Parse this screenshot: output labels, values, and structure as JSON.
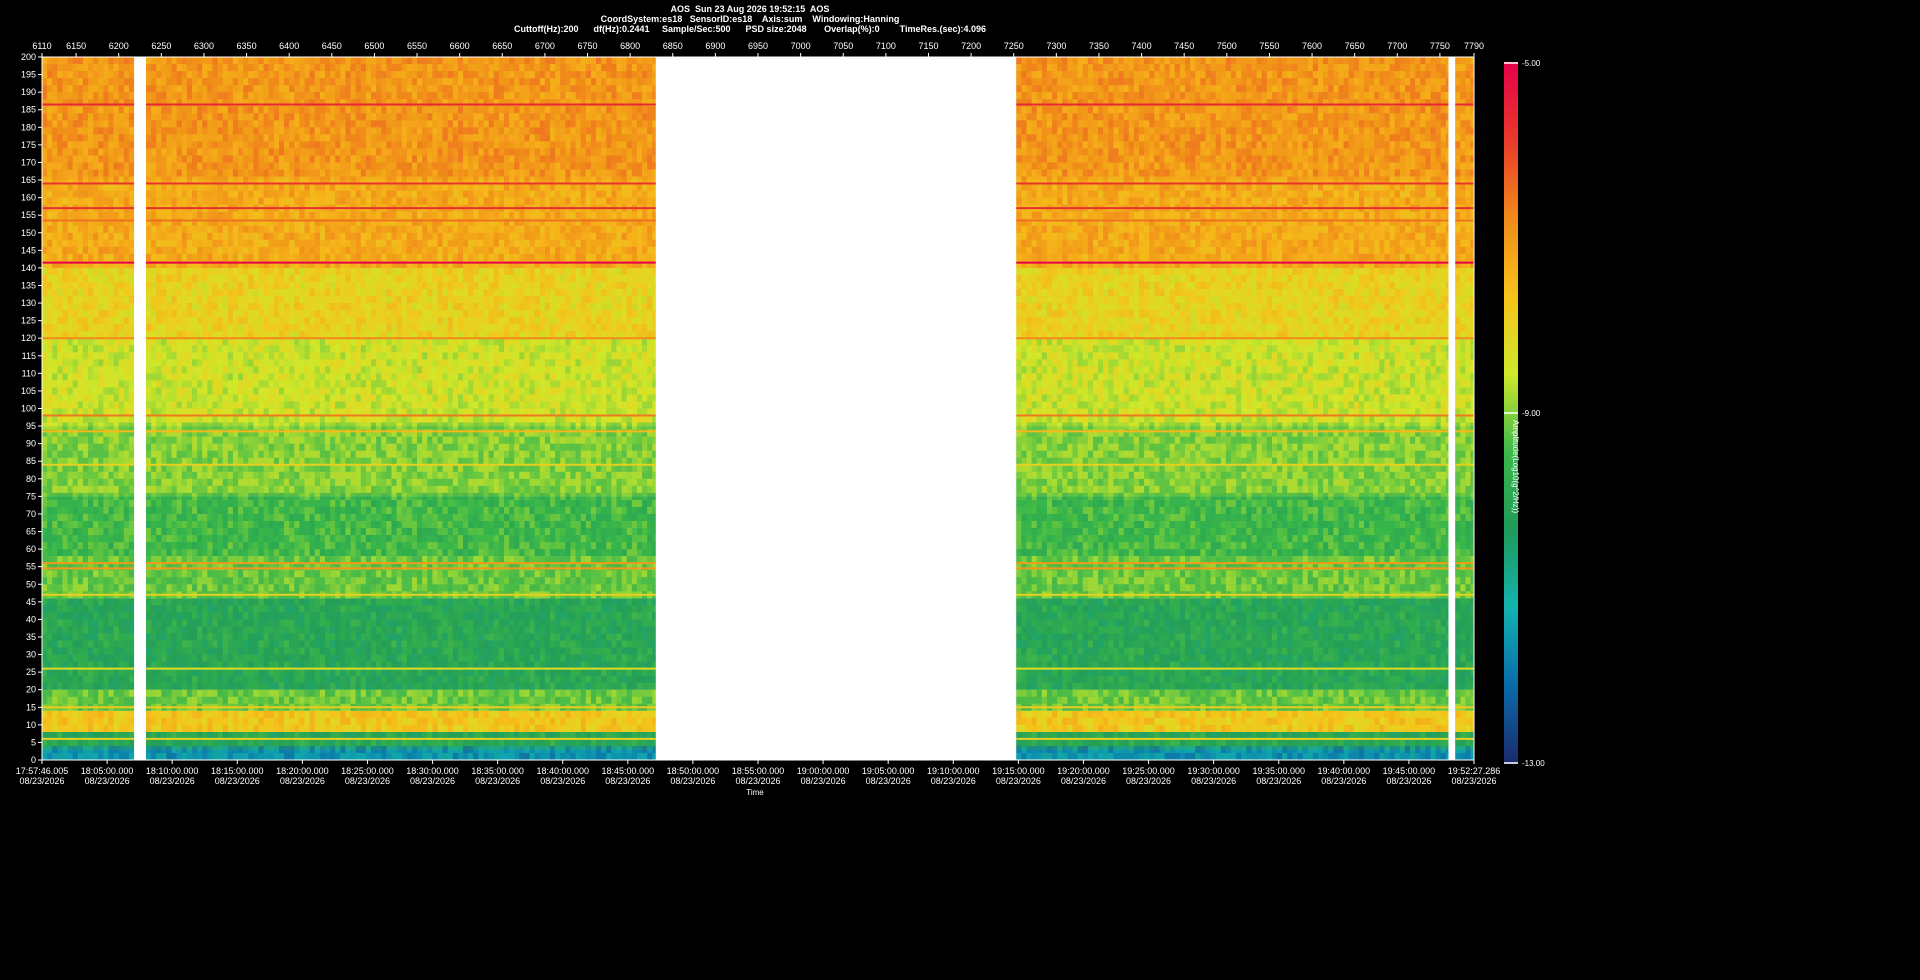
{
  "header": {
    "line1": "AOS  Sun 23 Aug 2026 19:52:15  AOS",
    "line2": "CoordSystem:es18   SensorID:es18    Axis:sum    Windowing:Hanning",
    "line3": "Cuttoff(Hz):200      df(Hz):0.2441     Sample/Sec:500      PSD size:2048       Overlap(%):0        TimeRes.(sec):4.096"
  },
  "chart_data": {
    "type": "heatmap",
    "title": "AOS  Sun 23 Aug 2026 19:52:15  AOS",
    "xlabel": "Time",
    "ylabel": "",
    "ylim": [
      0,
      200
    ],
    "top_axis": {
      "range": [
        6110,
        7790
      ],
      "ticks": [
        "6110",
        "6150",
        "6200",
        "6250",
        "6300",
        "6350",
        "6400",
        "6450",
        "6500",
        "6550",
        "6600",
        "6650",
        "6700",
        "6750",
        "6800",
        "6850",
        "6900",
        "6950",
        "7000",
        "7050",
        "7100",
        "7150",
        "7200",
        "7250",
        "7300",
        "7350",
        "7400",
        "7450",
        "7500",
        "7550",
        "7600",
        "7650",
        "7700",
        "7750",
        "7790"
      ]
    },
    "y_ticks": [
      0,
      5,
      10,
      15,
      20,
      25,
      30,
      35,
      40,
      45,
      50,
      55,
      60,
      65,
      70,
      75,
      80,
      85,
      90,
      95,
      100,
      105,
      110,
      115,
      120,
      125,
      130,
      135,
      140,
      145,
      150,
      155,
      160,
      165,
      170,
      175,
      180,
      185,
      190,
      195,
      200
    ],
    "time_ticks": [
      {
        "t": "17:57:46.005",
        "d": "08/23/2026"
      },
      {
        "t": "18:05:00.000",
        "d": "08/23/2026"
      },
      {
        "t": "18:10:00.000",
        "d": "08/23/2026"
      },
      {
        "t": "18:15:00.000",
        "d": "08/23/2026"
      },
      {
        "t": "18:20:00.000",
        "d": "08/23/2026"
      },
      {
        "t": "18:25:00.000",
        "d": "08/23/2026"
      },
      {
        "t": "18:30:00.000",
        "d": "08/23/2026"
      },
      {
        "t": "18:35:00.000",
        "d": "08/23/2026"
      },
      {
        "t": "18:40:00.000",
        "d": "08/23/2026"
      },
      {
        "t": "18:45:00.000",
        "d": "08/23/2026"
      },
      {
        "t": "18:50:00.000",
        "d": "08/23/2026"
      },
      {
        "t": "18:55:00.000",
        "d": "08/23/2026"
      },
      {
        "t": "19:00:00.000",
        "d": "08/23/2026"
      },
      {
        "t": "19:05:00.000",
        "d": "08/23/2026"
      },
      {
        "t": "19:10:00.000",
        "d": "08/23/2026"
      },
      {
        "t": "19:15:00.000",
        "d": "08/23/2026"
      },
      {
        "t": "19:20:00.000",
        "d": "08/23/2026"
      },
      {
        "t": "19:25:00.000",
        "d": "08/23/2026"
      },
      {
        "t": "19:30:00.000",
        "d": "08/23/2026"
      },
      {
        "t": "19:35:00.000",
        "d": "08/23/2026"
      },
      {
        "t": "19:40:00.000",
        "d": "08/23/2026"
      },
      {
        "t": "19:45:00.000",
        "d": "08/23/2026"
      },
      {
        "t": "19:52:27.286",
        "d": "08/23/2026"
      }
    ],
    "data_segments": [
      {
        "start": 6110,
        "end": 6218
      },
      {
        "start": 6232,
        "end": 6830
      },
      {
        "start": 7253,
        "end": 7760
      },
      {
        "start": 7768,
        "end": 7790
      }
    ],
    "spectral_lines": [
      {
        "freq": 186.5,
        "level": -5.6
      },
      {
        "freq": 164.0,
        "level": -5.8
      },
      {
        "freq": 157.0,
        "level": -5.7
      },
      {
        "freq": 153.5,
        "level": -6.5
      },
      {
        "freq": 141.5,
        "level": -5.0
      },
      {
        "freq": 120.0,
        "level": -6.8
      },
      {
        "freq": 98.0,
        "level": -6.6
      },
      {
        "freq": 93.5,
        "level": -7.5
      },
      {
        "freq": 84.0,
        "level": -8.0
      },
      {
        "freq": 56.0,
        "level": -7.0
      },
      {
        "freq": 54.5,
        "level": -7.0
      },
      {
        "freq": 47.0,
        "level": -8.0
      },
      {
        "freq": 26.0,
        "level": -8.3
      },
      {
        "freq": 15.0,
        "level": -7.8
      },
      {
        "freq": 6.0,
        "level": -8.0
      }
    ],
    "background_profile": [
      {
        "f0": 0,
        "f1": 3,
        "level": -11.6
      },
      {
        "f0": 3,
        "f1": 8,
        "level": -10.0
      },
      {
        "f0": 8,
        "f1": 14,
        "level": -7.8
      },
      {
        "f0": 14,
        "f1": 20,
        "level": -9.2
      },
      {
        "f0": 20,
        "f1": 46,
        "level": -10.0
      },
      {
        "f0": 46,
        "f1": 58,
        "level": -9.2
      },
      {
        "f0": 58,
        "f1": 75,
        "level": -9.5
      },
      {
        "f0": 75,
        "f1": 95,
        "level": -9.0
      },
      {
        "f0": 95,
        "f1": 120,
        "level": -8.5
      },
      {
        "f0": 120,
        "f1": 140,
        "level": -8.0
      },
      {
        "f0": 140,
        "f1": 165,
        "level": -7.3
      },
      {
        "f0": 165,
        "f1": 200,
        "level": -7.0
      }
    ],
    "colorbar": {
      "label": "Amplitude(Log10(g^2/Hz))",
      "max": "-5.00",
      "mid": "-9.00",
      "min": "-13.00",
      "colors": [
        "#1a2a6c",
        "#0a6aa8",
        "#12b3b0",
        "#1f9a5a",
        "#3bb84a",
        "#cfe82a",
        "#f7c21a",
        "#f08a1a",
        "#e83a2a",
        "#e6004a"
      ]
    }
  }
}
